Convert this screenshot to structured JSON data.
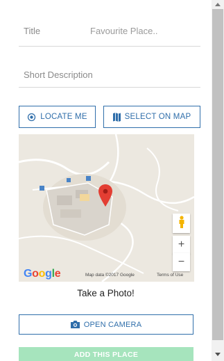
{
  "form": {
    "title_label": "Title",
    "title_value": "Favourite Place..",
    "description_label": "Short Description"
  },
  "buttons": {
    "locate": "LOCATE ME",
    "select_on_map": "SELECT ON MAP",
    "open_camera": "OPEN CAMERA",
    "add_place": "ADD THIS PLACE"
  },
  "map": {
    "logo": "Google",
    "data_text": "Map data ©2017 Google",
    "terms_text": "Terms of Use",
    "zoom_in": "+",
    "zoom_out": "−"
  },
  "photo": {
    "title": "Take a Photo!"
  },
  "colors": {
    "accent": "#2f6eaa",
    "add_button": "#a6e4bd",
    "marker": "#e33e33"
  },
  "icons": [
    "locate-icon",
    "map-icon",
    "camera-icon",
    "map-marker-icon",
    "pegman-icon",
    "scroll-up-arrow-icon",
    "scroll-down-arrow-icon"
  ]
}
